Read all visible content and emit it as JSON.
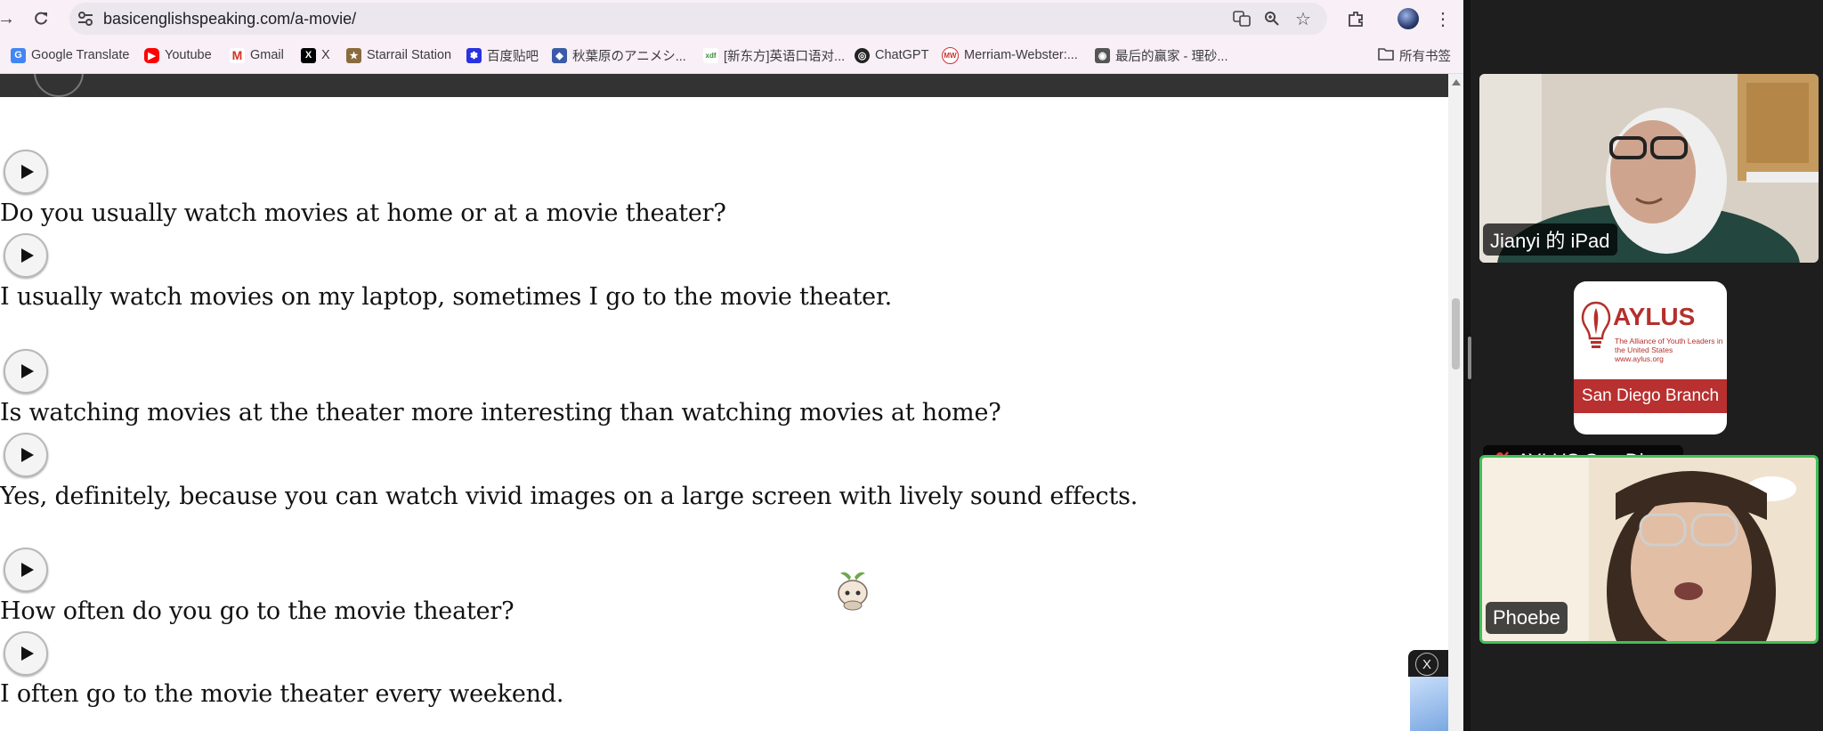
{
  "browser": {
    "url": "basicenglishspeaking.com/a-movie/",
    "bookmarks": [
      {
        "label": "Google Translate",
        "icon": "google-translate-icon"
      },
      {
        "label": "Youtube",
        "icon": "youtube-icon"
      },
      {
        "label": "Gmail",
        "icon": "gmail-icon"
      },
      {
        "label": "X",
        "icon": "x-icon"
      },
      {
        "label": "Starrail Station",
        "icon": "starrail-icon"
      },
      {
        "label": "百度贴吧",
        "icon": "baidu-icon"
      },
      {
        "label": "秋葉原のアニメシ...",
        "icon": "akiba-icon"
      },
      {
        "label": "[新东方]英语口语对...",
        "icon": "xdf-icon"
      },
      {
        "label": "ChatGPT",
        "icon": "chatgpt-icon"
      },
      {
        "label": "Merriam-Webster:...",
        "icon": "merriam-webster-icon"
      },
      {
        "label": "最后的赢家 - 理砂...",
        "icon": "site-icon"
      }
    ],
    "all_bookmarks": "所有书签"
  },
  "article": {
    "lines": [
      "Do you usually watch movies at home or at a movie theater?",
      "I usually watch movies on my laptop, sometimes I go to the movie theater.",
      "Is watching movies at the theater more interesting than watching movies at home?",
      "Yes, definitely, because you can watch vivid images on a large screen with lively sound effects.",
      "How often do you go to the movie theater?",
      "I often go to the movie theater every weekend."
    ]
  },
  "ad": {
    "close": "X"
  },
  "zoom": {
    "participants": [
      {
        "name": "Jianyi 的 iPad"
      },
      {
        "name": "AYLUS San Diego",
        "muted": true
      },
      {
        "name": "Phoebe",
        "active_speaker": true
      }
    ],
    "aylus_logo": {
      "word": "AYLUS",
      "tagline": "The Alliance of Youth Leaders in the United States",
      "site": "www.aylus.org",
      "branch": "San Diego Branch"
    }
  },
  "colors": {
    "active_speaker_border": "#40c057",
    "aylus_red": "#b4302c"
  }
}
